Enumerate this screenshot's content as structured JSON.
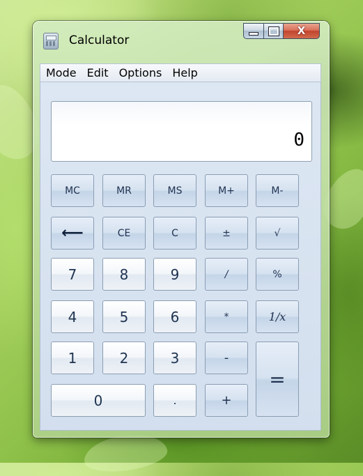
{
  "window": {
    "title": "Calculator",
    "caption_buttons": {
      "minimize": "minimize",
      "maximize": "maximize",
      "close": "x"
    }
  },
  "menu": [
    "Mode",
    "Edit",
    "Options",
    "Help"
  ],
  "display": {
    "value": "0"
  },
  "memory_row": [
    "MC",
    "MR",
    "MS",
    "M+",
    "M-"
  ],
  "edit_row": {
    "backspace": "⟵",
    "ce": "CE",
    "c": "C",
    "negate": "±",
    "sqrt": "√"
  },
  "keys": {
    "seven": "7",
    "eight": "8",
    "nine": "9",
    "divide": "/",
    "percent": "%",
    "four": "4",
    "five": "5",
    "six": "6",
    "multiply": "*",
    "reciprocal": "1/x",
    "one": "1",
    "two": "2",
    "three": "3",
    "subtract": "-",
    "equals": "=",
    "zero": "0",
    "decimal": ".",
    "add": "+"
  }
}
